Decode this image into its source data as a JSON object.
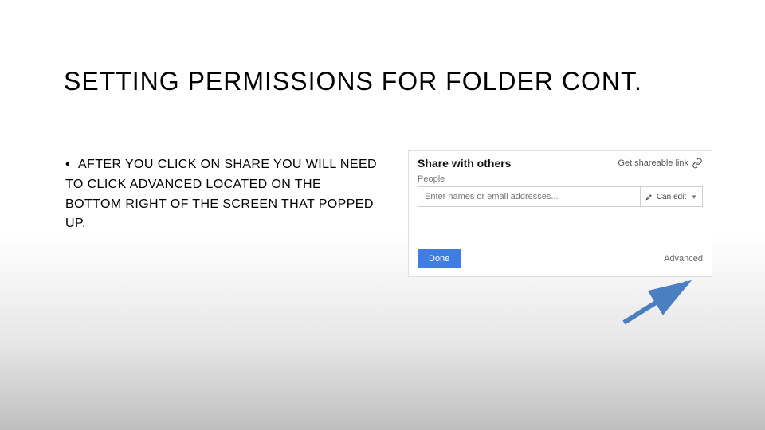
{
  "title": "SETTING PERMISSIONS FOR FOLDER CONT.",
  "bullet": "AFTER YOU CLICK ON SHARE YOU WILL NEED TO CLICK ADVANCED LOCATED ON THE BOTTOM RIGHT OF THE SCREEN THAT POPPED UP.",
  "dialog": {
    "title": "Share with others",
    "get_link": "Get shareable link",
    "people_label": "People",
    "input_placeholder": "Enter names or email addresses...",
    "perm_label": "Can edit",
    "done": "Done",
    "advanced": "Advanced"
  }
}
